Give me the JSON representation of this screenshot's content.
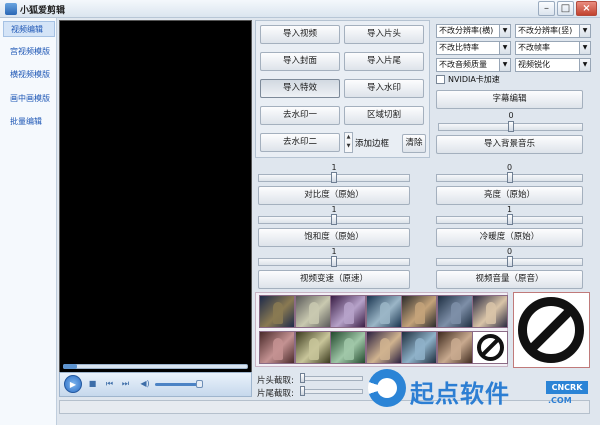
{
  "window": {
    "title": "小狐爱剪辑",
    "minimize": "–",
    "maximize": "□",
    "close": "×"
  },
  "sidebar": {
    "items": [
      {
        "label": "视频编辑",
        "active": true
      },
      {
        "label": "宫视频模版",
        "active": false
      },
      {
        "label": "横视频模版",
        "active": false
      },
      {
        "label": "画中画模版",
        "active": false
      },
      {
        "label": "批量编辑",
        "active": false
      }
    ]
  },
  "buttons": {
    "import_video": "导入视频",
    "import_head": "导入片头",
    "import_cover": "导入封面",
    "import_tail": "导入片尾",
    "import_effect": "导入特效",
    "import_watermark": "导入水印",
    "remove_watermark_1": "去水印一",
    "region_cut": "区域切割",
    "remove_watermark_2": "去水印二",
    "add_border": "添加边框",
    "clear": "清除",
    "subtitle_edit": "字幕编辑",
    "import_bgm": "导入背景音乐"
  },
  "selects": {
    "res_horizontal": "不改分辨率(横)",
    "res_vertical": "不改分辨率(竖)",
    "bitrate": "不改比特率",
    "framerate": "不改帧率",
    "audio_quality": "不改音频质量",
    "sharpen": "视频锐化",
    "arrow": "▼"
  },
  "nvidia": {
    "label": "NVIDIA卡加速",
    "checked": false
  },
  "bgm_slider": {
    "value": "0",
    "level": 0.5
  },
  "sliders": [
    {
      "value": "1",
      "label": "对比度（原始）",
      "level": 0.5
    },
    {
      "value": "0",
      "label": "亮度（原始）",
      "level": 0.5
    },
    {
      "value": "1",
      "label": "饱和度（原始）",
      "level": 0.5
    },
    {
      "value": "1",
      "label": "冷暖度（原始）",
      "level": 0.5
    },
    {
      "value": "1",
      "label": "视频变速（原速）",
      "level": 0.5
    },
    {
      "value": "0",
      "label": "视频音量（原音）",
      "level": 0.5
    }
  ],
  "player": {
    "play": "▶",
    "stop": "■",
    "prev": "⏮",
    "next": "⏭",
    "mute": "◀)",
    "progress": 0.05,
    "volume": 0.85
  },
  "trim": {
    "head_label": "片头截取:",
    "tail_label": "片尾截取:"
  },
  "filters": {
    "count": 14
  },
  "watermark": {
    "brand": "起点软件",
    "badge": "CNCRK",
    "url": ".COM"
  },
  "colors": {
    "accent": "#2b84d6",
    "video_bg": "#000000",
    "nav_text": "#1d56b5"
  }
}
